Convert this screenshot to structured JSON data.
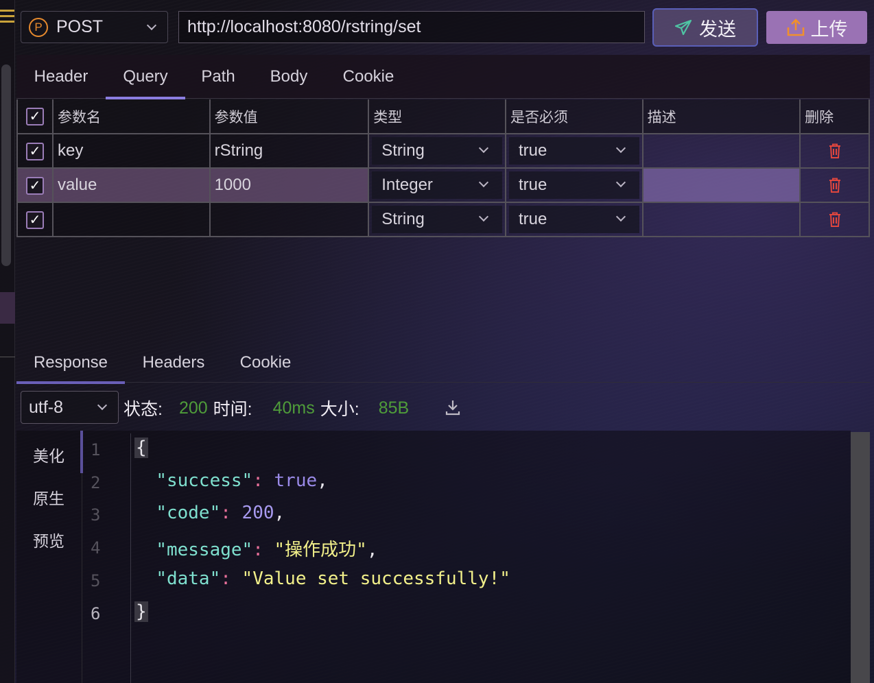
{
  "request": {
    "method": "POST",
    "method_badge": "P",
    "url": "http://localhost:8080/rstring/set",
    "send_label": "发送",
    "upload_label": "上传",
    "tabs": [
      {
        "label": "Header",
        "active": false
      },
      {
        "label": "Query",
        "active": true
      },
      {
        "label": "Path",
        "active": false
      },
      {
        "label": "Body",
        "active": false
      },
      {
        "label": "Cookie",
        "active": false
      }
    ]
  },
  "params": {
    "headers": {
      "name": "参数名",
      "value": "参数值",
      "type": "类型",
      "required": "是否必须",
      "description": "描述",
      "delete": "删除"
    },
    "rows": [
      {
        "checked": true,
        "name": "key",
        "value": "rString",
        "type": "String",
        "required": "true",
        "description": ""
      },
      {
        "checked": true,
        "name": "value",
        "value": "1000",
        "type": "Integer",
        "required": "true",
        "description": ""
      },
      {
        "checked": true,
        "name": "",
        "value": "",
        "type": "String",
        "required": "true",
        "description": ""
      }
    ]
  },
  "response": {
    "tabs": [
      {
        "label": "Response",
        "active": true
      },
      {
        "label": "Headers",
        "active": false
      },
      {
        "label": "Cookie",
        "active": false
      }
    ],
    "encoding": "utf-8",
    "status_label": "状态:",
    "status_value": "200",
    "time_label": "时间:",
    "time_value": "40ms",
    "size_label": "大小:",
    "size_value": "85B",
    "view_modes": [
      "美化",
      "原生",
      "预览"
    ],
    "line_numbers": [
      "1",
      "2",
      "3",
      "4",
      "5",
      "6"
    ],
    "body": {
      "open": "{",
      "close": "}",
      "fields": [
        {
          "key": "\"success\"",
          "value": "true",
          "kind": "bool",
          "comma": ","
        },
        {
          "key": "\"code\"",
          "value": "200",
          "kind": "num",
          "comma": ","
        },
        {
          "key": "\"message\"",
          "value": "\"操作成功\"",
          "kind": "str",
          "comma": ","
        },
        {
          "key": "\"data\"",
          "value": "\"Value set successfully!\"",
          "kind": "str",
          "comma": ""
        }
      ]
    }
  },
  "colors": {
    "accent": "#8b7de0",
    "method": "#e68a2e",
    "status_ok": "#4f9c3a",
    "delete": "#e0463e",
    "upload_bg": "#9a72b4"
  }
}
